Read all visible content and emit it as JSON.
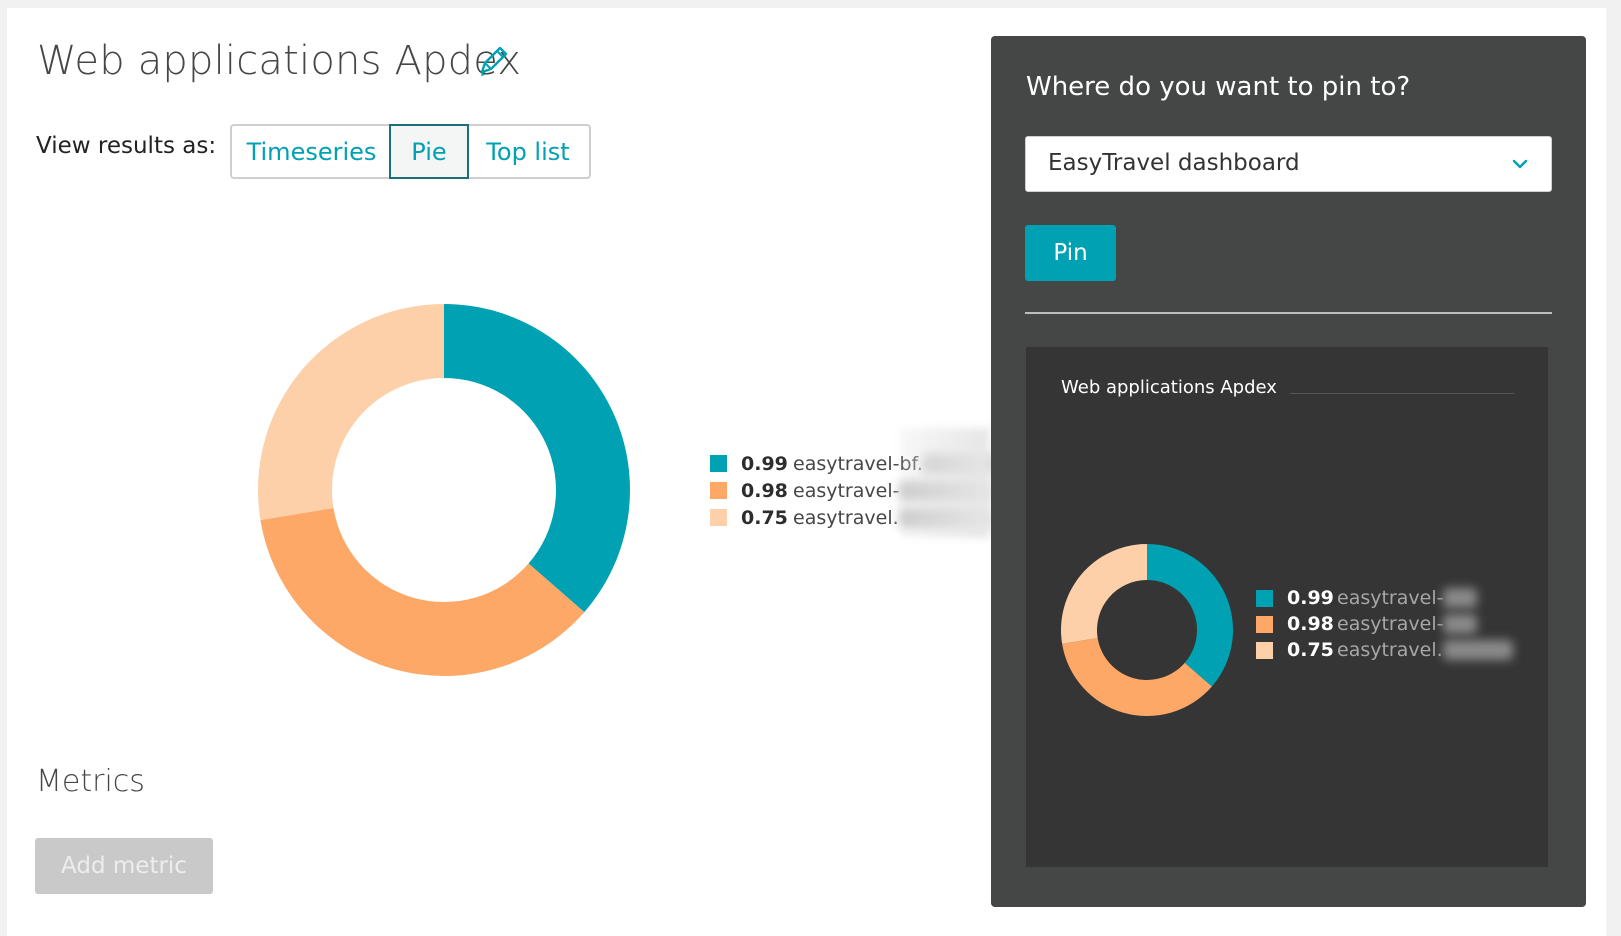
{
  "page": {
    "title": "Web applications Apdex",
    "view_label": "View results as:",
    "view_options": [
      "Timeseries",
      "Pie",
      "Top list"
    ],
    "selected_view": "Pie",
    "metrics_title": "Metrics",
    "add_metric_label": "Add metric"
  },
  "colors": {
    "accent": "#00a1b2",
    "series": [
      "#00a1b2",
      "#fea868",
      "#fdd0a9"
    ],
    "panel_bg": "#454646",
    "preview_bg": "#353535"
  },
  "chart_data": [
    {
      "type": "pie",
      "donut": true,
      "values": [
        0.99,
        0.98,
        0.75
      ],
      "labels": [
        "0.99",
        "0.98",
        "0.75"
      ],
      "names": [
        "easytravel-bf.",
        "easytravel-",
        "easytravel."
      ],
      "legend": "right"
    },
    {
      "type": "pie",
      "donut": true,
      "title": "Web applications Apdex",
      "values": [
        0.99,
        0.98,
        0.75
      ],
      "labels": [
        "0.99",
        "0.98",
        "0.75"
      ],
      "names": [
        "easytravel-",
        "easytravel-",
        "easytravel."
      ],
      "legend": "right"
    }
  ],
  "pin_panel": {
    "title": "Where do you want to pin to?",
    "dropdown_value": "EasyTravel dashboard",
    "pin_label": "Pin"
  }
}
